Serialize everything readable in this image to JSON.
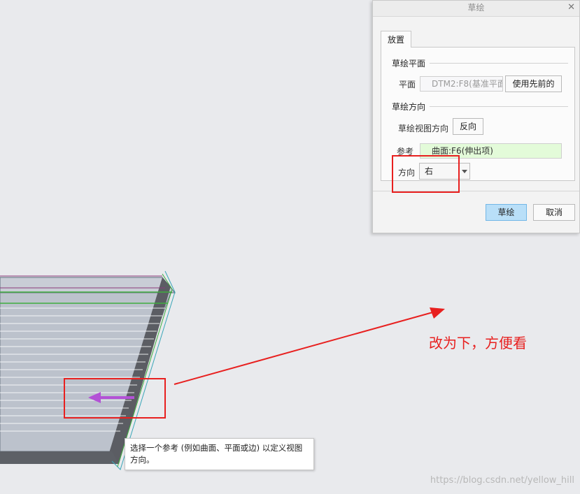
{
  "dialog": {
    "title": "草绘",
    "close_glyph": "✕",
    "tab_label": "放置",
    "sketch_plane_section": "草绘平面",
    "plane_label": "平面",
    "plane_value": "DTM2:F8(基准平面)",
    "use_previous_button": "使用先前的",
    "sketch_orientation_section": "草绘方向",
    "view_direction_label": "草绘视图方向",
    "flip_button": "反向",
    "reference_label": "参考",
    "reference_value": "曲面:F6(伸出项)",
    "orientation_label": "方向",
    "orientation_value": "右",
    "sketch_button": "草绘",
    "cancel_button": "取消"
  },
  "annotation": {
    "note_text": "改为下，方便看",
    "annotation_color": "#e8201f"
  },
  "tooltip": {
    "text": "选择一个参考 (例如曲面、平面或边) 以定义视图方向。"
  },
  "watermark": "https://blog.csdn.net/yellow_hill",
  "colors": {
    "reference_field_bg": "#e3fbd9",
    "primary_button_bg": "#b9dff8",
    "direction_arrow": "#b352d6"
  }
}
